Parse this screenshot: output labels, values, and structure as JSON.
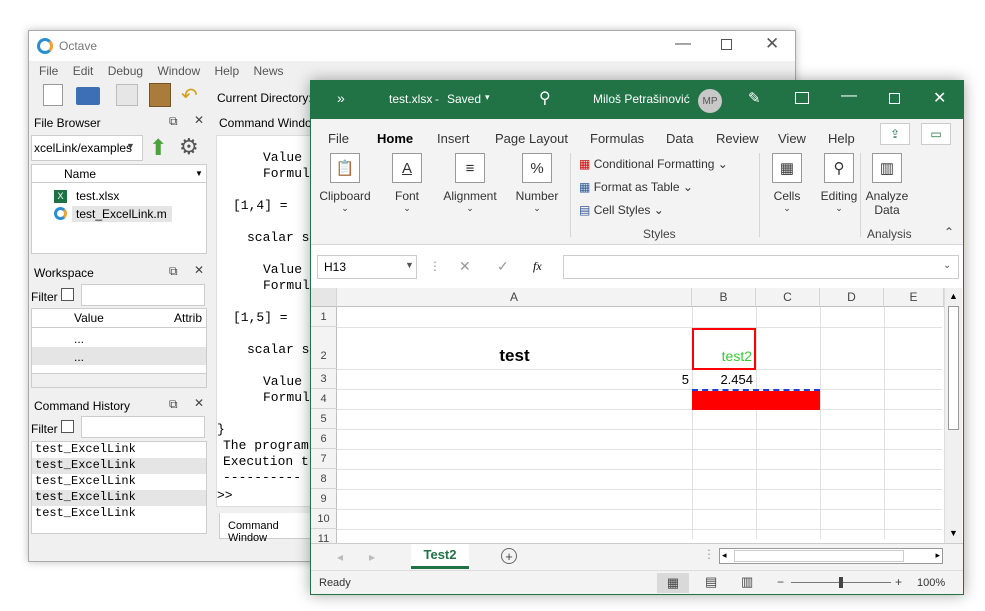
{
  "octave": {
    "title": "Octave",
    "menu": [
      "File",
      "Edit",
      "Debug",
      "Window",
      "Help",
      "News"
    ],
    "current_dir_label": "Current Directory:",
    "file_browser": {
      "title": "File Browser",
      "path": "xcelLink/examples",
      "name_header": "Name",
      "files": [
        "test.xlsx",
        "test_ExcelLink.m"
      ]
    },
    "workspace": {
      "title": "Workspace",
      "filter": "Filter",
      "cols": [
        "Value",
        "Attrib"
      ],
      "rows": [
        "...",
        "..."
      ]
    },
    "history": {
      "title": "Command History",
      "filter": "Filter",
      "items": [
        "test_ExcelLink",
        "test_ExcelLink",
        "test_ExcelLink",
        "test_ExcelLink",
        "test_ExcelLink"
      ]
    },
    "cmd_tab": "Command Window",
    "cmd_tab_bottom": "Command Window",
    "cmd_lines": [
      "Value",
      "Formul",
      "[1,4] =",
      "scalar s",
      "Value",
      "Formul",
      "[1,5] =",
      "scalar s",
      "Value",
      "Formul",
      "}",
      "The program",
      "Execution t",
      "----------",
      ">>"
    ]
  },
  "excel": {
    "qat": "»",
    "file": "test.xlsx",
    "saved": "Saved",
    "user": "Miloš Petrašinović",
    "initials": "MP",
    "tabs": [
      "File",
      "Home",
      "Insert",
      "Page Layout",
      "Formulas",
      "Data",
      "Review",
      "View",
      "Help"
    ],
    "groups": {
      "clipboard": "Clipboard",
      "font": "Font",
      "alignment": "Alignment",
      "number": "Number",
      "cond": "Conditional Formatting",
      "table": "Format as Table",
      "styles_btn": "Cell Styles",
      "styles": "Styles",
      "cells": "Cells",
      "editing": "Editing",
      "analyze1": "Analyze",
      "analyze2": "Data",
      "analysis": "Analysis"
    },
    "namebox": "H13",
    "fx": "fx",
    "cols": [
      "A",
      "B",
      "C",
      "D",
      "E"
    ],
    "rows": [
      "1",
      "2",
      "3",
      "4",
      "5",
      "6",
      "7",
      "8",
      "9",
      "10",
      "11"
    ],
    "cells": {
      "a2": "test",
      "b2": "test2",
      "a3": "5",
      "b3": "2.454"
    },
    "sheet": "Test2",
    "status": "Ready",
    "zoom": "100%",
    "colors": {
      "green": "#217346",
      "red": "#ff0000"
    }
  }
}
